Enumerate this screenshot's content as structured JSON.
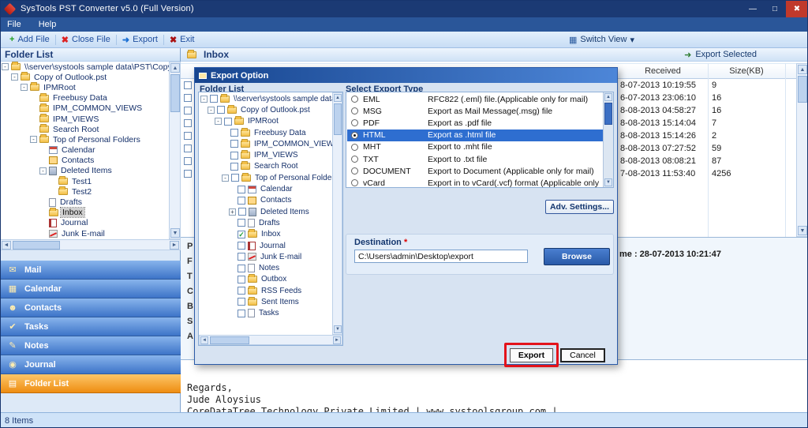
{
  "colors": {
    "titlebar": "#1b3a74",
    "menubar": "#2a5699",
    "dialog_title": "#17458f",
    "selected_row": "#2e6ed0",
    "nav_orange": "#ee8d12",
    "browse_button": "#2a5aa8",
    "annotation": "#e3131b"
  },
  "icons": {
    "minimize": "—",
    "maximize": "□",
    "close": "✖",
    "add_file": "+",
    "close_file": "✖",
    "export_arrow": "➜",
    "exit": "✖",
    "switch_view": "▦",
    "caret_down": "▾",
    "export_selected": "➜",
    "nav_mail": "✉",
    "nav_calendar": "▦",
    "nav_contacts": "☻",
    "nav_tasks": "✔",
    "nav_notes": "✎",
    "nav_journal": "◉",
    "nav_folder_list": "▤",
    "up": "▲",
    "down": "▼",
    "left": "◄",
    "right": "►",
    "expand_open": "-",
    "expand_closed": "+",
    "check": "✓"
  },
  "titlebar": {
    "title": "SysTools  PST Converter v5.0 (Full Version)"
  },
  "menu": {
    "file": "File",
    "help": "Help"
  },
  "toolbar": {
    "add_file": "Add File",
    "close_file": "Close File",
    "export": "Export",
    "exit": "Exit",
    "switch_view": "Switch View"
  },
  "left_panel": {
    "header": "Folder List",
    "tree": [
      "\\\\server\\systools sample data\\PST\\Copy of C",
      "Copy of Outlook.pst",
      "IPMRoot",
      "Freebusy Data",
      "IPM_COMMON_VIEWS",
      "IPM_VIEWS",
      "Search Root",
      "Top of Personal Folders",
      "Calendar",
      "Contacts",
      "Deleted Items",
      "Test1",
      "Test2",
      "Drafts",
      "Inbox",
      "Journal",
      "Junk E-mail"
    ],
    "nav": [
      "Mail",
      "Calendar",
      "Contacts",
      "Tasks",
      "Notes",
      "Journal",
      "Folder List"
    ]
  },
  "statusbar": {
    "items_count": "8 Items"
  },
  "content": {
    "title": "Inbox",
    "export_selected": "Export Selected",
    "columns": {
      "received": "Received",
      "size": "Size(KB)"
    },
    "rows": [
      {
        "received": "8-07-2013 10:19:55",
        "size": "9"
      },
      {
        "received": "6-07-2013 23:06:10",
        "size": "16"
      },
      {
        "received": "8-08-2013 04:58:27",
        "size": "16"
      },
      {
        "received": "8-08-2013 15:14:04",
        "size": "7"
      },
      {
        "received": "8-08-2013 15:14:26",
        "size": "2"
      },
      {
        "received": "8-08-2013 07:27:52",
        "size": "59"
      },
      {
        "received": "8-08-2013 08:08:21",
        "size": "87"
      },
      {
        "received": "7-08-2013 11:53:40",
        "size": "4256"
      }
    ],
    "reading_pane": {
      "label_fragments": [
        "P",
        "F",
        "T",
        "C",
        "B",
        "S",
        "A"
      ],
      "time_fragment": "me : 28-07-2013 10:21:47"
    },
    "message_body": [
      "Regards,",
      "Jude Aloysius",
      "CoreDataTree Technology Private Limited | www.systoolsgroup.com |"
    ]
  },
  "dialog": {
    "title": "Export Option",
    "folder_list_label": "Folder List",
    "tree": [
      "\\\\server\\systools sample data\\PST\\",
      "Copy of Outlook.pst",
      "IPMRoot",
      "Freebusy Data",
      "IPM_COMMON_VIEWS",
      "IPM_VIEWS",
      "Search Root",
      "Top of Personal Folders",
      "Calendar",
      "Contacts",
      "Deleted Items",
      "Drafts",
      "Inbox",
      "Journal",
      "Junk E-mail",
      "Notes",
      "Outbox",
      "RSS Feeds",
      "Sent Items",
      "Tasks"
    ],
    "select_type_label": "Select Export Type",
    "types": [
      {
        "name": "EML",
        "desc": "RFC822 (.eml) file.(Applicable only for mail)"
      },
      {
        "name": "MSG",
        "desc": "Export as Mail Message(.msg) file"
      },
      {
        "name": "PDF",
        "desc": "Export as .pdf file"
      },
      {
        "name": "HTML",
        "desc": "Export as .html file"
      },
      {
        "name": "MHT",
        "desc": "Export to .mht file"
      },
      {
        "name": "TXT",
        "desc": "Export to .txt file"
      },
      {
        "name": "DOCUMENT",
        "desc": "Export to Document (Applicable only for mail)"
      },
      {
        "name": "vCard",
        "desc": "Export in to vCard(.vcf) format (Applicable only for Contact)"
      }
    ],
    "adv_settings": "Adv. Settings...",
    "destination_label": "Destination",
    "required_mark": "*",
    "destination_value": "C:\\Users\\admin\\Desktop\\export",
    "browse": "Browse",
    "export": "Export",
    "cancel": "Cancel"
  }
}
